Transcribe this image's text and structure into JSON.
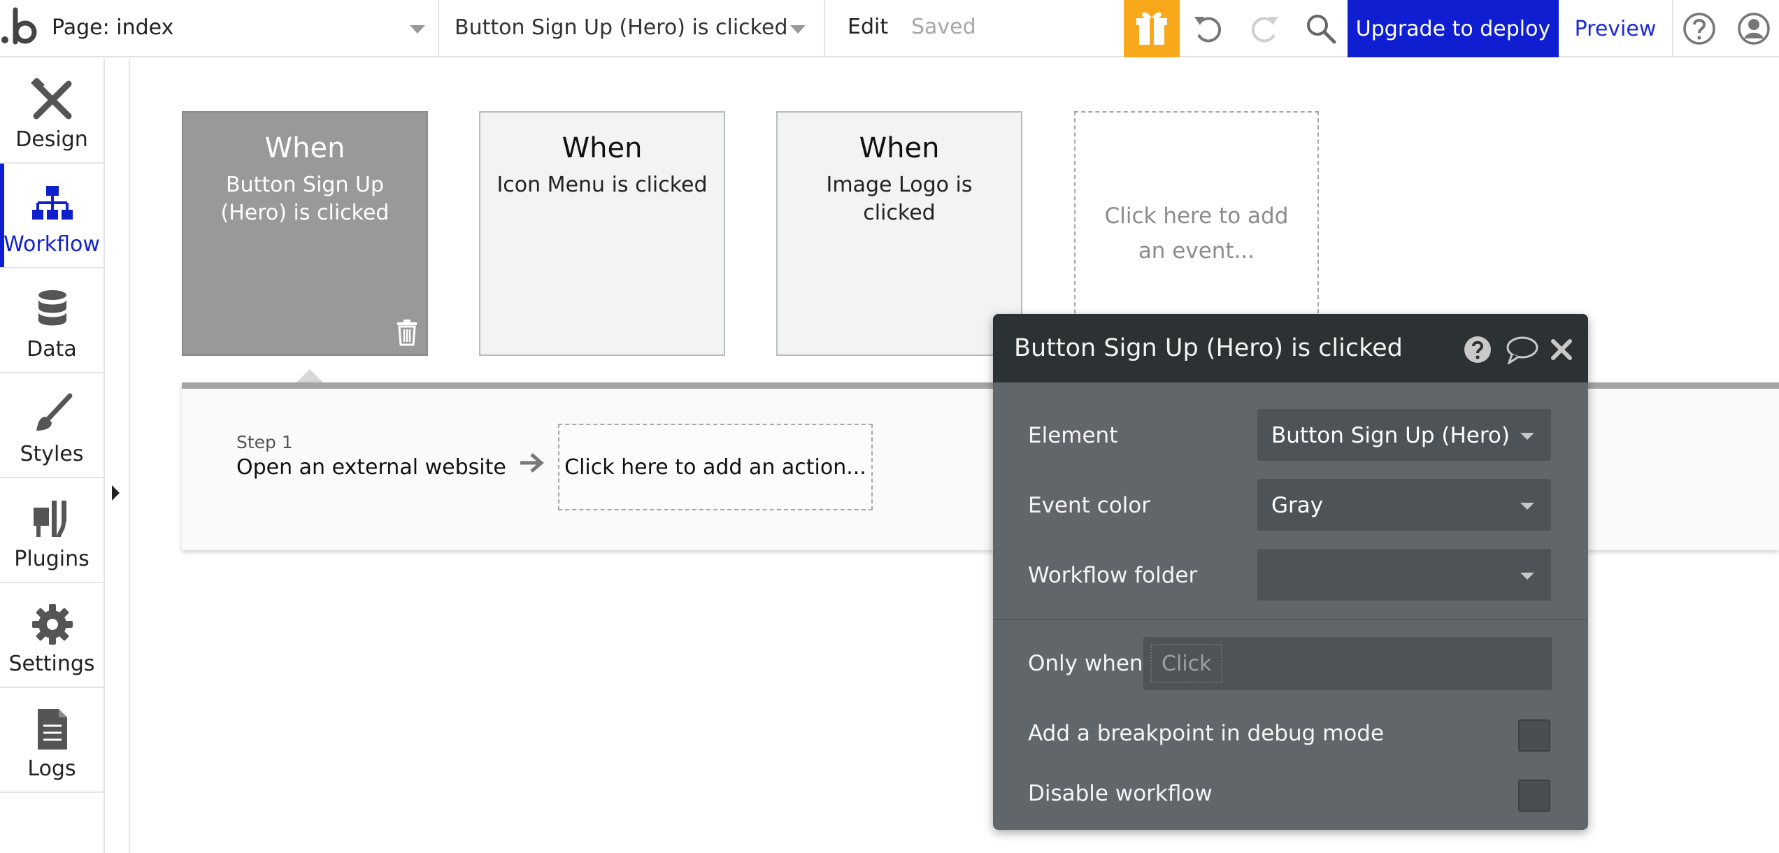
{
  "topbar": {
    "page_selector": "Page: index",
    "workflow_selector": "Button Sign Up (Hero) is clicked",
    "edit_label": "Edit",
    "saved_label": "Saved",
    "upgrade_label": "Upgrade to deploy",
    "preview_label": "Preview",
    "accent_color": "#0e1ed0",
    "gift_color": "#f7a81b"
  },
  "sidebar": {
    "items": [
      {
        "label": "Design",
        "icon": "design-tools-icon"
      },
      {
        "label": "Workflow",
        "icon": "workflow-tree-icon",
        "active": true
      },
      {
        "label": "Data",
        "icon": "database-icon"
      },
      {
        "label": "Styles",
        "icon": "paintbrush-icon"
      },
      {
        "label": "Plugins",
        "icon": "plug-icon"
      },
      {
        "label": "Settings",
        "icon": "gear-icon"
      },
      {
        "label": "Logs",
        "icon": "document-icon"
      }
    ]
  },
  "events": [
    {
      "when": "When",
      "description": "Button Sign Up (Hero) is clicked",
      "selected": true
    },
    {
      "when": "When",
      "description": "Icon Menu is clicked"
    },
    {
      "when": "When",
      "description": "Image Logo is clicked"
    }
  ],
  "add_event_label": "Click here to add an event...",
  "workflow": {
    "step_number": "Step 1",
    "step_action": "Open an external website",
    "add_action_label": "Click here to add an action..."
  },
  "popup": {
    "title": "Button Sign Up (Hero) is clicked",
    "element_label": "Element",
    "element_value": "Button Sign Up (Hero)",
    "event_color_label": "Event color",
    "event_color_value": "Gray",
    "workflow_folder_label": "Workflow folder",
    "workflow_folder_value": "",
    "only_when_label": "Only when",
    "only_when_placeholder": "Click",
    "breakpoint_label": "Add a breakpoint in debug mode",
    "breakpoint_checked": false,
    "disable_label": "Disable workflow",
    "disable_checked": false
  }
}
